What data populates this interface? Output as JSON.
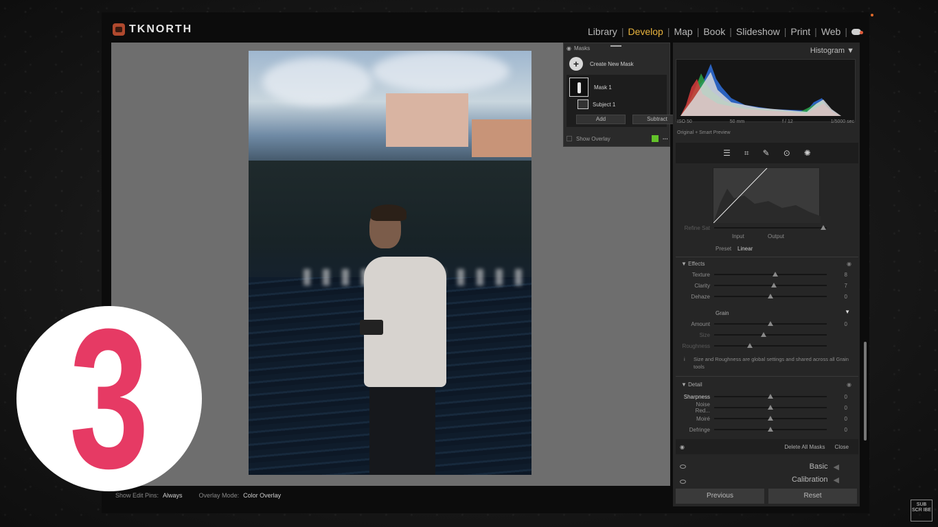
{
  "brand": {
    "name": "TKNORTH"
  },
  "modules": [
    "Library",
    "Develop",
    "Map",
    "Book",
    "Slideshow",
    "Print",
    "Web"
  ],
  "active_module": "Develop",
  "masks_panel": {
    "title": "Masks",
    "create_new": "Create New Mask",
    "mask_name": "Mask 1",
    "component_name": "Subject 1",
    "add_label": "Add",
    "subtract_label": "Subtract",
    "show_overlay_label": "Show Overlay",
    "overlay_color": "#63c22a"
  },
  "bottom_bar": {
    "show_edit_pins_label": "Show Edit Pins:",
    "show_edit_pins_value": "Always",
    "overlay_mode_label": "Overlay Mode:",
    "overlay_mode_value": "Color Overlay"
  },
  "histogram": {
    "title": "Histogram",
    "iso": "ISO 50",
    "focal": "50 mm",
    "aperture": "f / 12",
    "shutter": "1/5000 sec",
    "preview_label": "Original + Smart Preview"
  },
  "curve": {
    "refine_sat": "Refine Sat",
    "input_label": "Input",
    "output_label": "Output",
    "preset_label": "Preset",
    "preset_value": "Linear"
  },
  "effects": {
    "title": "Effects",
    "sliders": [
      {
        "label": "Texture",
        "value": "8",
        "pos": 0.54
      },
      {
        "label": "Clarity",
        "value": "7",
        "pos": 0.53
      },
      {
        "label": "Dehaze",
        "value": "0",
        "pos": 0.5
      }
    ]
  },
  "grain": {
    "title": "Grain",
    "sliders": [
      {
        "label": "Amount",
        "value": "0",
        "pos": 0.5
      },
      {
        "label": "Size",
        "value": "",
        "pos": 0.44
      },
      {
        "label": "Roughness",
        "value": "",
        "pos": 0.32
      }
    ],
    "note": "Size and Roughness are global settings and shared across all Grain tools"
  },
  "detail": {
    "title": "Detail",
    "sliders": [
      {
        "label": "Sharpness",
        "value": "0",
        "pos": 0.5
      },
      {
        "label": "Noise Red...",
        "value": "0",
        "pos": 0.5
      },
      {
        "label": "Moiré",
        "value": "0",
        "pos": 0.5
      },
      {
        "label": "Defringe",
        "value": "0",
        "pos": 0.5
      }
    ]
  },
  "mask_footer": {
    "delete_all": "Delete All Masks",
    "close": "Close"
  },
  "collapsed_sections": [
    "Basic",
    "Calibration"
  ],
  "buttons": {
    "previous": "Previous",
    "reset": "Reset"
  },
  "overlay": {
    "number": "3",
    "number_color": "#e63a64"
  },
  "subscribe_badge": "SUB SCR IBE"
}
